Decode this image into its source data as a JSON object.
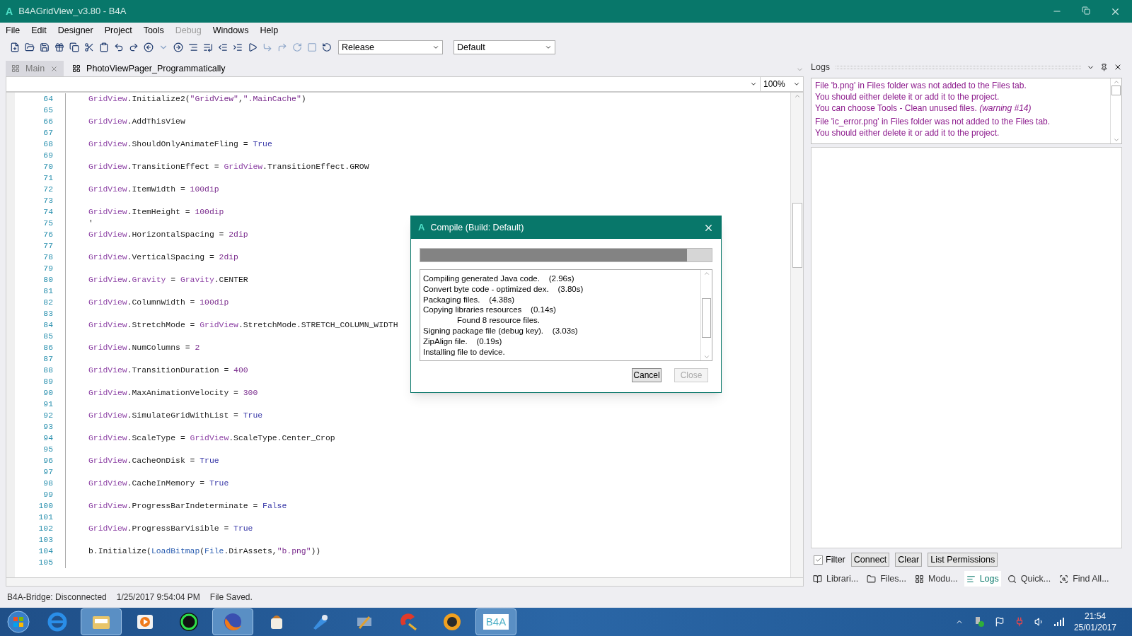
{
  "window": {
    "logo": "A",
    "title": "B4AGridView_v3.80 - B4A"
  },
  "menu": [
    {
      "label": "File",
      "disabled": false
    },
    {
      "label": "Edit",
      "disabled": false
    },
    {
      "label": "Designer",
      "disabled": false
    },
    {
      "label": "Project",
      "disabled": false
    },
    {
      "label": "Tools",
      "disabled": false
    },
    {
      "label": "Debug",
      "disabled": true
    },
    {
      "label": "Windows",
      "disabled": false
    },
    {
      "label": "Help",
      "disabled": false
    }
  ],
  "toolbar": {
    "build_mode": "Release",
    "build_config": "Default"
  },
  "tabs": [
    {
      "label": "Main",
      "selected": true,
      "closable": true
    },
    {
      "label": "PhotoViewPager_Programmatically",
      "selected": false,
      "closable": false
    }
  ],
  "editor": {
    "zoom": "100%",
    "lines": [
      {
        "number": "64",
        "tokens": [
          {
            "text": "GridView",
            "kind": "type"
          },
          {
            "text": ".Initialize2(",
            "kind": "plain"
          },
          {
            "text": "\"GridView\"",
            "kind": "string"
          },
          {
            "text": ",",
            "kind": "plain"
          },
          {
            "text": "\".MainCache\"",
            "kind": "string"
          },
          {
            "text": ")",
            "kind": "plain"
          }
        ]
      },
      {
        "number": "65"
      },
      {
        "number": "66",
        "tokens": [
          {
            "text": "GridView",
            "kind": "type"
          },
          {
            "text": ".AddThisView",
            "kind": "plain"
          }
        ]
      },
      {
        "number": "67"
      },
      {
        "number": "68",
        "tokens": [
          {
            "text": "GridView",
            "kind": "type"
          },
          {
            "text": ".ShouldOnlyAnimateFling = ",
            "kind": "plain"
          },
          {
            "text": "True",
            "kind": "keyword"
          }
        ]
      },
      {
        "number": "69"
      },
      {
        "number": "70",
        "tokens": [
          {
            "text": "GridView",
            "kind": "type"
          },
          {
            "text": ".TransitionEffect = ",
            "kind": "plain"
          },
          {
            "text": "GridView",
            "kind": "type"
          },
          {
            "text": ".TransitionEffect.GROW",
            "kind": "plain"
          }
        ]
      },
      {
        "number": "71"
      },
      {
        "number": "72",
        "tokens": [
          {
            "text": "GridView",
            "kind": "type"
          },
          {
            "text": ".ItemWidth = ",
            "kind": "plain"
          },
          {
            "text": "100dip",
            "kind": "number"
          }
        ]
      },
      {
        "number": "73"
      },
      {
        "number": "74",
        "tokens": [
          {
            "text": "GridView",
            "kind": "type"
          },
          {
            "text": ".ItemHeight = ",
            "kind": "plain"
          },
          {
            "text": "100dip",
            "kind": "number"
          }
        ]
      },
      {
        "number": "75",
        "tokens": [
          {
            "text": "'",
            "kind": "plain"
          }
        ]
      },
      {
        "number": "76",
        "tokens": [
          {
            "text": "GridView",
            "kind": "type"
          },
          {
            "text": ".HorizontalSpacing = ",
            "kind": "plain"
          },
          {
            "text": "2dip",
            "kind": "number"
          }
        ]
      },
      {
        "number": "77"
      },
      {
        "number": "78",
        "tokens": [
          {
            "text": "GridView",
            "kind": "type"
          },
          {
            "text": ".VerticalSpacing = ",
            "kind": "plain"
          },
          {
            "text": "2dip",
            "kind": "number"
          }
        ]
      },
      {
        "number": "79"
      },
      {
        "number": "80",
        "tokens": [
          {
            "text": "GridView",
            "kind": "type"
          },
          {
            "text": ".",
            "kind": "plain"
          },
          {
            "text": "Gravity",
            "kind": "type"
          },
          {
            "text": " = ",
            "kind": "plain"
          },
          {
            "text": "Gravity",
            "kind": "type"
          },
          {
            "text": ".CENTER",
            "kind": "plain"
          }
        ]
      },
      {
        "number": "81"
      },
      {
        "number": "82",
        "tokens": [
          {
            "text": "GridView",
            "kind": "type"
          },
          {
            "text": ".ColumnWidth = ",
            "kind": "plain"
          },
          {
            "text": "100dip",
            "kind": "number"
          }
        ]
      },
      {
        "number": "83"
      },
      {
        "number": "84",
        "tokens": [
          {
            "text": "GridView",
            "kind": "type"
          },
          {
            "text": ".StretchMode = ",
            "kind": "plain"
          },
          {
            "text": "GridView",
            "kind": "type"
          },
          {
            "text": ".StretchMode.STRETCH_COLUMN_WIDTH",
            "kind": "plain"
          }
        ]
      },
      {
        "number": "85"
      },
      {
        "number": "86",
        "tokens": [
          {
            "text": "GridView",
            "kind": "type"
          },
          {
            "text": ".NumColumns = ",
            "kind": "plain"
          },
          {
            "text": "2",
            "kind": "number"
          }
        ]
      },
      {
        "number": "87"
      },
      {
        "number": "88",
        "tokens": [
          {
            "text": "GridView",
            "kind": "type"
          },
          {
            "text": ".TransitionDuration = ",
            "kind": "plain"
          },
          {
            "text": "400",
            "kind": "number"
          }
        ]
      },
      {
        "number": "89"
      },
      {
        "number": "90",
        "tokens": [
          {
            "text": "GridView",
            "kind": "type"
          },
          {
            "text": ".MaxAnimationVelocity = ",
            "kind": "plain"
          },
          {
            "text": "300",
            "kind": "number"
          }
        ]
      },
      {
        "number": "91"
      },
      {
        "number": "92",
        "tokens": [
          {
            "text": "GridView",
            "kind": "type"
          },
          {
            "text": ".SimulateGridWithList = ",
            "kind": "plain"
          },
          {
            "text": "True",
            "kind": "keyword"
          }
        ]
      },
      {
        "number": "93"
      },
      {
        "number": "94",
        "tokens": [
          {
            "text": "GridView",
            "kind": "type"
          },
          {
            "text": ".ScaleType = ",
            "kind": "plain"
          },
          {
            "text": "GridView",
            "kind": "type"
          },
          {
            "text": ".ScaleType.Center_Crop",
            "kind": "plain"
          }
        ]
      },
      {
        "number": "95"
      },
      {
        "number": "96",
        "tokens": [
          {
            "text": "GridView",
            "kind": "type"
          },
          {
            "text": ".CacheOnDisk = ",
            "kind": "plain"
          },
          {
            "text": "True",
            "kind": "keyword"
          }
        ]
      },
      {
        "number": "97"
      },
      {
        "number": "98",
        "tokens": [
          {
            "text": "GridView",
            "kind": "type"
          },
          {
            "text": ".CacheInMemory = ",
            "kind": "plain"
          },
          {
            "text": "True",
            "kind": "keyword"
          }
        ]
      },
      {
        "number": "99"
      },
      {
        "number": "100",
        "tokens": [
          {
            "text": "GridView",
            "kind": "type"
          },
          {
            "text": ".ProgressBarIndeterminate = ",
            "kind": "plain"
          },
          {
            "text": "False",
            "kind": "keyword"
          }
        ]
      },
      {
        "number": "101"
      },
      {
        "number": "102",
        "tokens": [
          {
            "text": "GridView",
            "kind": "type"
          },
          {
            "text": ".ProgressBarVisible = ",
            "kind": "plain"
          },
          {
            "text": "True",
            "kind": "keyword"
          }
        ]
      },
      {
        "number": "103"
      },
      {
        "number": "104",
        "tokens": [
          {
            "text": "b.Initialize(",
            "kind": "plain"
          },
          {
            "text": "LoadBitmap",
            "kind": "function"
          },
          {
            "text": "(",
            "kind": "plain"
          },
          {
            "text": "File",
            "kind": "function"
          },
          {
            "text": ".DirAssets,",
            "kind": "plain"
          },
          {
            "text": "\"b.png\"",
            "kind": "string"
          },
          {
            "text": "))",
            "kind": "plain"
          }
        ]
      },
      {
        "number": "105"
      }
    ]
  },
  "dialog": {
    "logo": "A",
    "title": "Compile (Build: Default)",
    "progress": {
      "level": 0.915
    },
    "log": [
      {
        "text": "Compiling generated Java code.    (2.96s)",
        "kind": "step"
      },
      {
        "text": "Convert byte code - optimized dex.    (3.80s)",
        "kind": "step"
      },
      {
        "text": "Packaging files.    (4.38s)",
        "kind": "step"
      },
      {
        "text": "Copying libraries resources    (0.14s)",
        "kind": "step"
      },
      {
        "text": "Found 8 resource files.",
        "kind": "detail"
      },
      {
        "text": "Signing package file (debug key).    (3.03s)",
        "kind": "step"
      },
      {
        "text": "ZipAlign file.    (0.19s)",
        "kind": "step"
      },
      {
        "text": "Installing file to device.",
        "kind": "step"
      }
    ],
    "buttons": [
      {
        "label": "Cancel",
        "disabled": false
      },
      {
        "label": "Close",
        "disabled": true
      }
    ]
  },
  "logs_panel": {
    "title": "Logs",
    "messages": [
      {
        "lines": [
          "File 'b.png' in Files folder was not added to the Files tab.",
          "You should either delete it or add it to the project.",
          "You can choose Tools - Clean unused files. *(warning #14)*"
        ]
      },
      {
        "lines": [
          "File 'ic_error.png' in Files folder was not added to the Files tab.",
          "You should either delete it or add it to the project."
        ]
      }
    ],
    "filter": {
      "label": "Filter",
      "checked": true
    },
    "buttons": [
      "Connect",
      "Clear",
      "List Permissions"
    ],
    "bottom_tabs": [
      {
        "label": "Librari...",
        "selected": false
      },
      {
        "label": "Files...",
        "selected": false
      },
      {
        "label": "Modu...",
        "selected": false
      },
      {
        "label": "Logs",
        "selected": true
      },
      {
        "label": "Quick...",
        "selected": false
      },
      {
        "label": "Find All...",
        "selected": false
      }
    ]
  },
  "status_bar": [
    "B4A-Bridge: Disconnected",
    "1/25/2017 9:54:04 PM",
    "File Saved."
  ],
  "taskbar": {
    "apps": [
      {
        "active": false
      },
      {
        "active": true
      },
      {
        "active": false
      },
      {
        "active": false
      },
      {
        "active": true
      },
      {
        "active": false
      },
      {
        "active": false
      },
      {
        "active": false
      },
      {
        "active": false
      },
      {
        "active": false
      },
      {
        "active": true,
        "label": "B4A"
      }
    ],
    "time": "21:54",
    "date": "25/01/2017"
  }
}
